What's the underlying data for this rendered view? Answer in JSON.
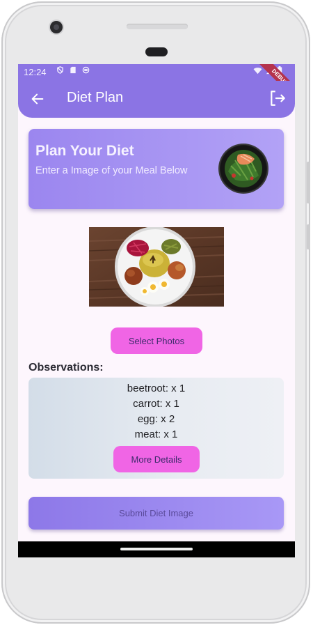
{
  "status_bar": {
    "time": "12:24",
    "left_icons": [
      "shield-icon",
      "sd-card-icon",
      "sync-icon"
    ],
    "right_icons": [
      "wifi-icon",
      "signal-icon",
      "battery-icon"
    ],
    "debug_label": "DEBUG"
  },
  "app_bar": {
    "title": "Diet Plan",
    "back_icon": "arrow-left-icon",
    "logout_icon": "logout-icon",
    "color": "#8b74e4"
  },
  "hero": {
    "title": "Plan Your Diet",
    "subtitle": "Enter a Image of your Meal Below"
  },
  "actions": {
    "select_photos": "Select Photos",
    "more_details": "More Details",
    "submit": "Submit Diet Image"
  },
  "observations": {
    "title": "Observations:",
    "items": [
      "beetroot: x 1",
      "carrot: x 1",
      "egg: x 2",
      "meat: x 1"
    ]
  },
  "colors": {
    "accent_button": "#f065e5",
    "primary": "#8b74e4"
  }
}
